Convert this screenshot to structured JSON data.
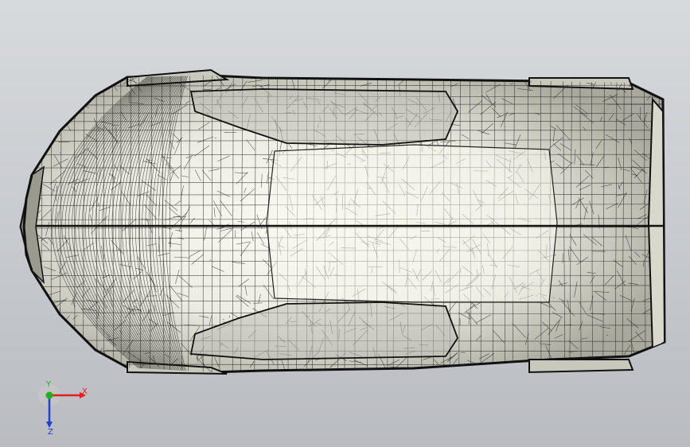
{
  "viewport": {
    "background_top": "#d7dadd",
    "background_bottom": "#b9bcc1"
  },
  "model": {
    "display_mode": "wireframe-shaded",
    "edge_color": "#1a1a1a",
    "face_color": "#e6e6dc",
    "shadow_color": "#b4b4a8"
  },
  "triad": {
    "x_label": "X",
    "y_label": "Y",
    "z_label": "Z",
    "x_color": "#e02020",
    "y_color": "#20b020",
    "z_color": "#2040d0"
  }
}
